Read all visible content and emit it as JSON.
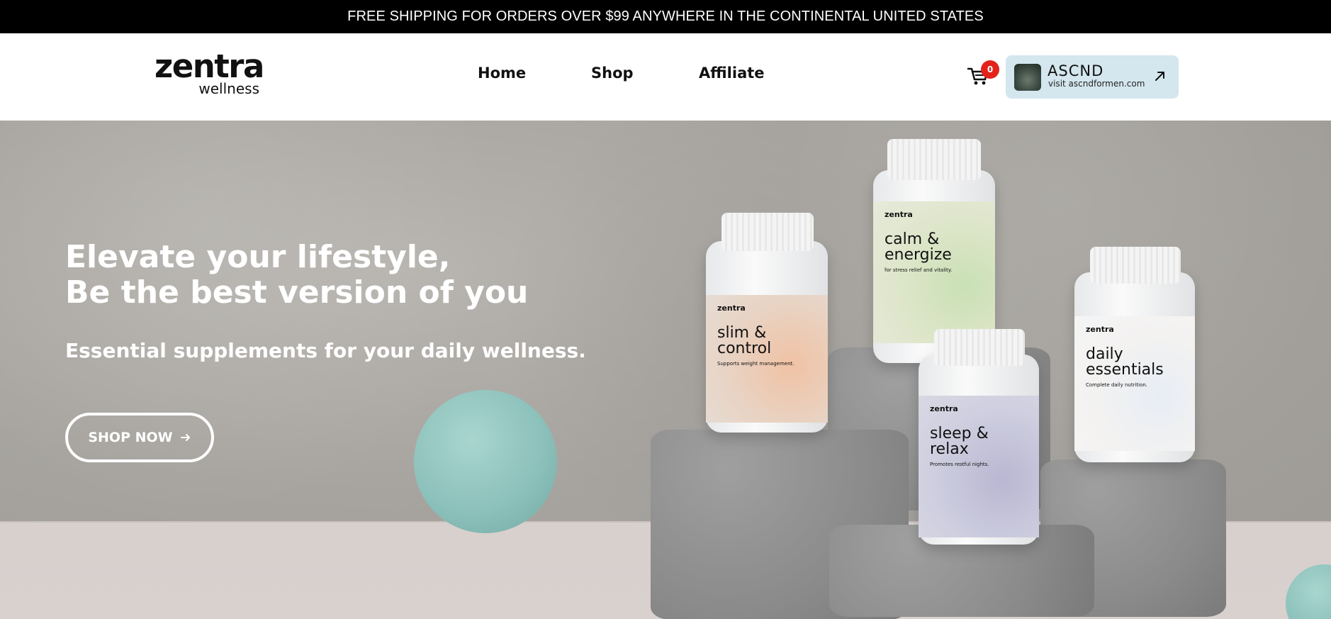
{
  "announcement": {
    "text": "FREE SHIPPING FOR ORDERS OVER $99 ANYWHERE IN THE CONTINENTAL UNITED STATES"
  },
  "header": {
    "logo_word": "zentra",
    "logo_sub": "wellness",
    "nav": [
      "Home",
      "Shop",
      "Affiliate"
    ],
    "cart_count": "0",
    "promo": {
      "brand": "ASCND",
      "url": "visit ascndformen.com"
    }
  },
  "hero": {
    "headline_line1": "Elevate your lifestyle,",
    "headline_line2": "Be the best version of you",
    "subheadline": "Essential supplements for your daily wellness.",
    "cta_label": "SHOP NOW",
    "products": [
      {
        "mini_logo": "zentra",
        "name": "slim & control",
        "tag": "Supports weight management."
      },
      {
        "mini_logo": "zentra",
        "name": "calm & energize",
        "tag": "for stress relief and vitality."
      },
      {
        "mini_logo": "zentra",
        "name": "sleep & relax",
        "tag": "Promotes restful nights."
      },
      {
        "mini_logo": "zentra",
        "name": "daily essentials",
        "tag": "Complete daily nutrition."
      }
    ]
  },
  "colors": {
    "announcement_bg": "#000000",
    "cart_badge": "#e2231a",
    "promo_bg": "#d4e6ee",
    "orb": "#8dc1bb"
  },
  "icons": [
    "cart-icon",
    "arrow-up-right-icon",
    "arrow-right-icon"
  ]
}
